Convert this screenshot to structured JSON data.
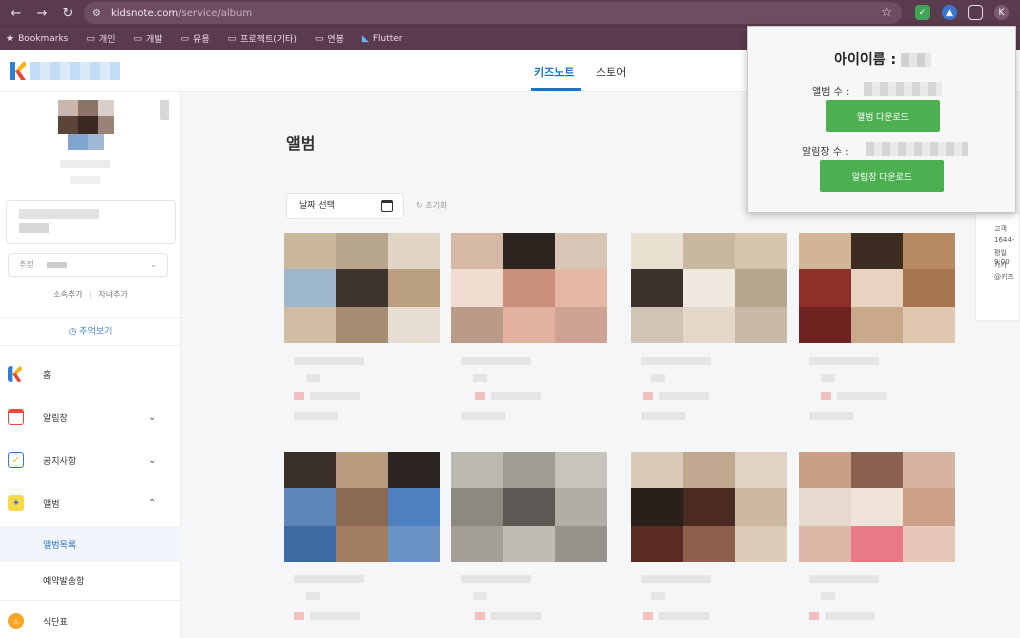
{
  "browser": {
    "url_domain": "kidsnote.com",
    "url_path": "/service/album",
    "bookmarks": [
      {
        "label": "Bookmarks",
        "icon": "star-icon"
      },
      {
        "label": "개인",
        "icon": "folder-icon"
      },
      {
        "label": "개발",
        "icon": "folder-icon"
      },
      {
        "label": "유용",
        "icon": "folder-icon"
      },
      {
        "label": "프로젝트(기타)",
        "icon": "folder-icon"
      },
      {
        "label": "연봉",
        "icon": "folder-icon"
      },
      {
        "label": "Flutter",
        "icon": "flutter-icon"
      }
    ],
    "profile_initial": "K"
  },
  "header": {
    "tabs": [
      {
        "label": "키즈노트",
        "active": true
      },
      {
        "label": "스토어",
        "active": false
      }
    ]
  },
  "sidebar": {
    "select_prefix": "추정",
    "link_add_affiliation": "소속추가",
    "link_add_child": "자녀추가",
    "memory_button": "추억보기",
    "menu": [
      {
        "label": "홈",
        "icon": "kidsnote-logo-icon"
      },
      {
        "label": "알림장",
        "icon": "calendar-icon"
      },
      {
        "label": "공지사항",
        "icon": "checklist-icon"
      },
      {
        "label": "앨범",
        "icon": "album-icon"
      }
    ],
    "sub_menu": [
      {
        "label": "앨범목록",
        "active": true
      },
      {
        "label": "예약발송함",
        "active": false
      }
    ],
    "menu_last": {
      "label": "식단표",
      "icon": "meal-icon"
    }
  },
  "main": {
    "title": "앨범",
    "date_picker_label": "날짜 선택",
    "reset_label": "초기화"
  },
  "popup": {
    "title": "아이이름 :",
    "album_count_label": "앨범 수 :",
    "album_download_button": "앨범 다운로드",
    "notice_count_label": "알림장 수 :",
    "notice_download_button": "알림장 다운로드",
    "accent_color": "#4caf50"
  },
  "right_card": {
    "lines": [
      "고객",
      "1644-",
      "평일 9:00",
      "카카",
      "@키즈"
    ]
  },
  "colors": {
    "chrome": "#5a3b4e",
    "brand_blue": "#1a73c8"
  }
}
